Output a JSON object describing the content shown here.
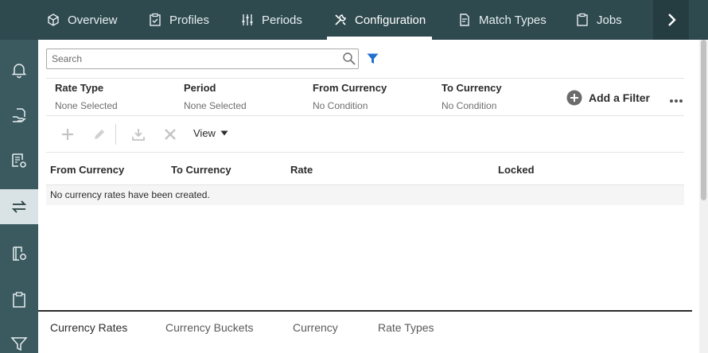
{
  "top_nav": {
    "tabs": [
      {
        "label": "Overview",
        "icon": "cube-icon"
      },
      {
        "label": "Profiles",
        "icon": "clipboard-check-icon"
      },
      {
        "label": "Periods",
        "icon": "sliders-icon"
      },
      {
        "label": "Configuration",
        "icon": "tools-icon",
        "active": true
      },
      {
        "label": "Match Types",
        "icon": "document-icon"
      },
      {
        "label": "Jobs",
        "icon": "clipboard-icon"
      }
    ],
    "next_icon": "chevron-right-icon"
  },
  "left_rail": {
    "items": [
      {
        "icon": "bell-icon"
      },
      {
        "icon": "hand-document-icon"
      },
      {
        "icon": "report-gear-icon"
      },
      {
        "icon": "swap-arrows-icon",
        "active": true
      },
      {
        "icon": "book-gear-icon"
      },
      {
        "icon": "clipboard-icon"
      },
      {
        "icon": "funnel-icon"
      }
    ]
  },
  "search": {
    "placeholder": "Search",
    "value": ""
  },
  "filters": [
    {
      "header": "Rate Type",
      "value": "None Selected"
    },
    {
      "header": "Period",
      "value": "None Selected"
    },
    {
      "header": "From Currency",
      "value": "No Condition"
    },
    {
      "header": "To Currency",
      "value": "No Condition"
    }
  ],
  "add_filter_label": "Add a Filter",
  "more_label": "•••",
  "toolbar": {
    "view_label": "View"
  },
  "table": {
    "columns": [
      "From Currency",
      "To Currency",
      "Rate",
      "Locked"
    ],
    "empty_message": "No currency rates have been created."
  },
  "bottom_tabs": [
    {
      "label": "Currency Rates",
      "active": true
    },
    {
      "label": "Currency Buckets"
    },
    {
      "label": "Currency"
    },
    {
      "label": "Rate Types"
    }
  ],
  "colors": {
    "nav_bg": "#2f4a4f",
    "rail_bg": "#3b5a60",
    "accent_blue": "#2a6fc9"
  }
}
